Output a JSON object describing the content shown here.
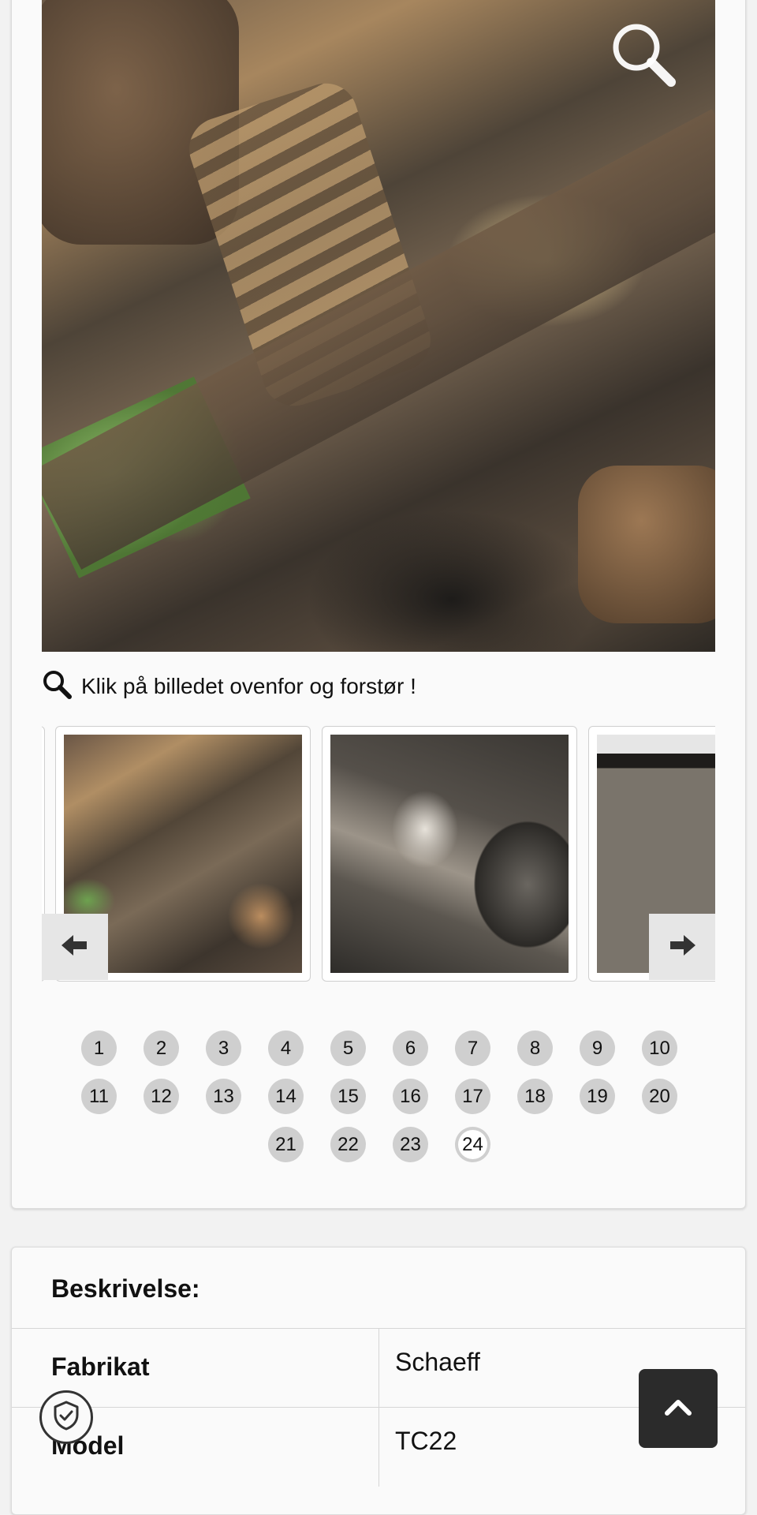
{
  "gallery": {
    "zoom_hint": "Klik på billedet ovenfor og forstør !",
    "thumbnails": [
      {
        "name": "thumb-undercarriage"
      },
      {
        "name": "thumb-wheel-hub"
      },
      {
        "name": "thumb-track-side"
      }
    ],
    "pager": {
      "rows": [
        [
          "1",
          "2",
          "3",
          "4",
          "5",
          "6",
          "7",
          "8",
          "9",
          "10"
        ],
        [
          "11",
          "12",
          "13",
          "14",
          "15",
          "16",
          "17",
          "18",
          "19",
          "20"
        ],
        [
          "21",
          "22",
          "23",
          "24"
        ]
      ],
      "active": "24"
    },
    "icons": {
      "zoom": "search-icon",
      "prev": "arrow-left-icon",
      "next": "arrow-right-icon"
    }
  },
  "description": {
    "title": "Beskrivelse:",
    "rows": [
      {
        "key": "Fabrikat",
        "value": "Schaeff"
      },
      {
        "key": "Model",
        "value": "TC22"
      }
    ]
  },
  "floating": {
    "privacy_icon": "shield-check-icon",
    "scroll_top_icon": "chevron-up-icon"
  }
}
